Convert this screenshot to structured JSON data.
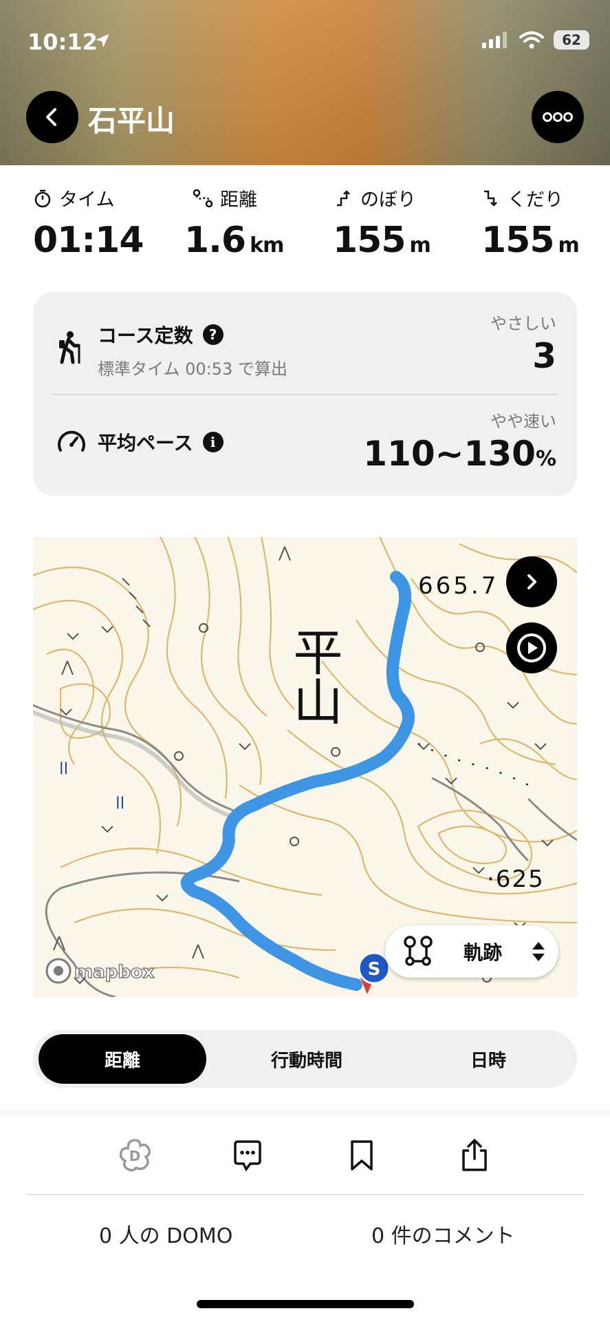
{
  "status": {
    "time": "10:12",
    "battery": "62"
  },
  "header": {
    "title": "石平山"
  },
  "stats": [
    {
      "label": "タイム",
      "value": "01:14",
      "unit": ""
    },
    {
      "label": "距離",
      "value": "1.6",
      "unit": "km"
    },
    {
      "label": "のぼり",
      "value": "155",
      "unit": "m"
    },
    {
      "label": "くだり",
      "value": "155",
      "unit": "m"
    }
  ],
  "course": {
    "title": "コース定数",
    "sub": "標準タイム 00:53 で算出",
    "rating": "やさしい",
    "value": "3"
  },
  "pace": {
    "title": "平均ペース",
    "rating": "やや速い",
    "value": "110~130",
    "unit": "%"
  },
  "map": {
    "labels": {
      "mountain_text": "平山",
      "elev1": "665.7",
      "elev2": "·625",
      "attribution": "mapbox"
    },
    "track_label": "軌跡",
    "start_marker": "S",
    "colors": {
      "track": "#3d95e3",
      "contour": "#d9b56a"
    }
  },
  "segments": [
    {
      "label": "距離",
      "selected": true
    },
    {
      "label": "行動時間",
      "selected": false
    },
    {
      "label": "日時",
      "selected": false
    }
  ],
  "footer": {
    "domo": "0 人の DOMO",
    "comments": "0 件のコメント"
  }
}
